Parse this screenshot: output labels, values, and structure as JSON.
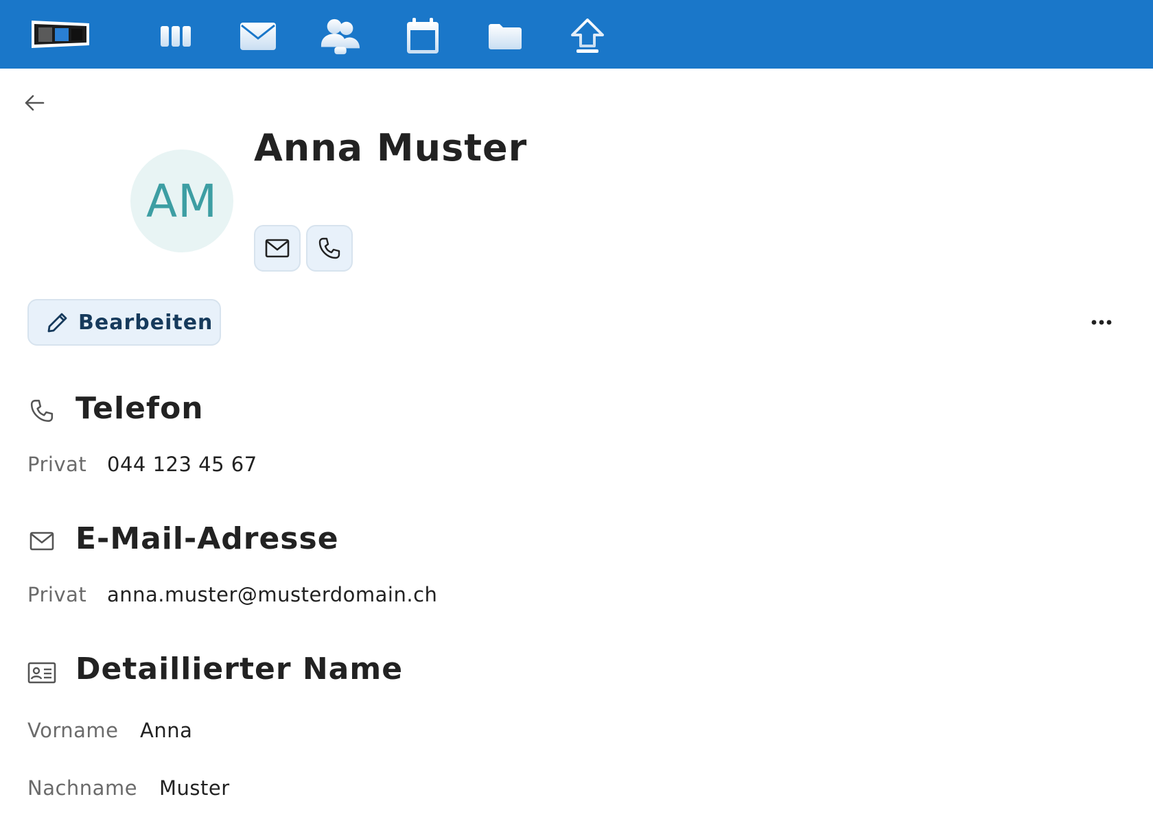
{
  "contact": {
    "name": "Anna Muster",
    "initials": "AM"
  },
  "actions": {
    "edit_label": "Bearbeiten"
  },
  "sections": {
    "phone": {
      "title": "Telefon",
      "entries": [
        {
          "label": "Privat",
          "value": "044 123 45 67"
        }
      ]
    },
    "email": {
      "title": "E-Mail-Adresse",
      "entries": [
        {
          "label": "Privat",
          "value": "anna.muster@musterdomain.ch"
        }
      ]
    },
    "detailed_name": {
      "title": "Detaillierter Name",
      "entries": [
        {
          "label": "Vorname",
          "value": "Anna"
        },
        {
          "label": "Nachname",
          "value": "Muster"
        }
      ]
    }
  },
  "nav": {
    "items": [
      "dashboard-icon",
      "mail-icon",
      "contacts-icon",
      "calendar-icon",
      "files-icon",
      "upload-icon"
    ]
  },
  "colors": {
    "topbar": "#1a77c9",
    "avatar_bg": "#e8f4f4",
    "avatar_text": "#3d9ea3",
    "button_bg": "#e8f1fa",
    "edit_text": "#163a5c"
  }
}
